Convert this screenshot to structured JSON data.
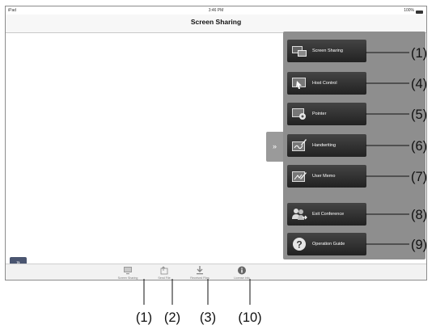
{
  "status_bar": {
    "carrier": "iPad",
    "time": "3:46 PM",
    "battery": "100%"
  },
  "nav": {
    "title": "Screen Sharing"
  },
  "menu": {
    "items": [
      {
        "label": "Screen Sharing",
        "icon": "screen-sharing-icon",
        "callout": "(1)"
      },
      {
        "label": "Host Control",
        "icon": "host-control-icon",
        "callout": "(4)"
      },
      {
        "label": "Pointer",
        "icon": "pointer-icon",
        "callout": "(5)"
      },
      {
        "label": "Handwriting",
        "icon": "handwriting-icon",
        "callout": "(6)"
      },
      {
        "label": "User Memo",
        "icon": "user-memo-icon",
        "callout": "(7)"
      },
      {
        "label": "Exit Conference",
        "icon": "exit-conference-icon",
        "callout": "(8)"
      },
      {
        "label": "Operation Guide",
        "icon": "operation-guide-icon",
        "callout": "(9)"
      }
    ],
    "collapse_glyph": "»"
  },
  "corner_button": {
    "glyph": "»"
  },
  "tabs": [
    {
      "label": "Screen Sharing",
      "icon": "monitor-icon",
      "callout": "(1)"
    },
    {
      "label": "Send File",
      "icon": "send-file-icon",
      "callout": "(2)"
    },
    {
      "label": "Received Files",
      "icon": "download-icon",
      "callout": "(3)"
    },
    {
      "label": "License Info",
      "icon": "info-icon",
      "callout": "(10)"
    }
  ],
  "colors": {
    "panel": "#8e8e8e",
    "button": "#2f2f2f",
    "tabbar": "#f2f2f2"
  }
}
